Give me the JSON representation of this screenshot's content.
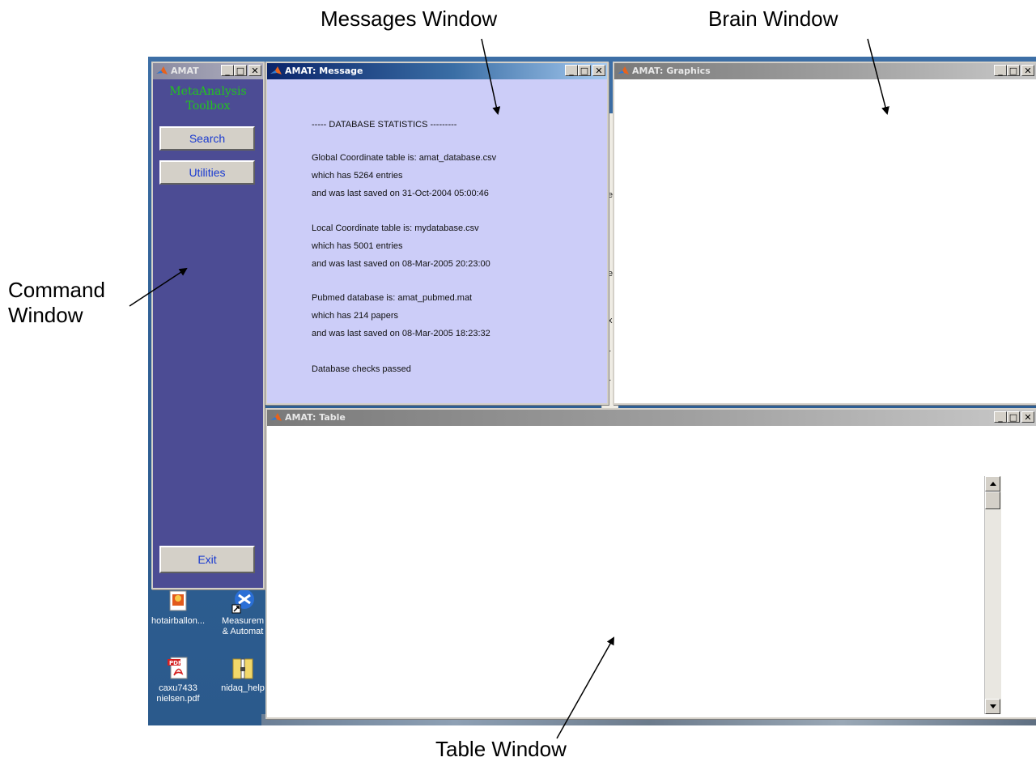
{
  "annotations": {
    "messages_label": "Messages Window",
    "brain_label": "Brain Window",
    "command_label_line1": "Command",
    "command_label_line2": "Window",
    "table_label": "Table Window"
  },
  "command_window": {
    "title": "AMAT",
    "heading_line1": "MetaAnalysis",
    "heading_line2": "Toolbox",
    "heading_color": "#22c41e",
    "panel_color": "#4c4c94",
    "buttons": {
      "search": "Search",
      "utilities": "Utilities",
      "exit": "Exit"
    }
  },
  "message_window": {
    "title": "AMAT: Message",
    "background": "#cccdf8",
    "lines": [
      "----- DATABASE STATISTICS ---------",
      "Global Coordinate table is: amat_database.csv",
      "which has 5264 entries",
      "and was last saved on 31-Oct-2004 05:00:46",
      "Local Coordinate table is: mydatabase.csv",
      "which has 5001 entries",
      "and was last saved on 08-Mar-2005 20:23:00",
      "Pubmed database is: amat_pubmed.mat",
      "which has 214 papers",
      "and was last saved on 08-Mar-2005 18:23:32",
      "Database checks passed"
    ]
  },
  "graphics_window": {
    "title": "AMAT: Graphics"
  },
  "table_window": {
    "title": "AMAT: Table"
  },
  "title_buttons": {
    "minimize": "_",
    "maximize": "□",
    "close": "✕"
  },
  "desktop_icons": [
    {
      "label_line1": "hotairballon...",
      "label_line2": "",
      "icon": "image-file-icon"
    },
    {
      "label_line1": "Measurem",
      "label_line2": "& Automat",
      "icon": "shortcut-app-icon"
    },
    {
      "label_line1": "caxu7433",
      "label_line2": "nielsen.pdf",
      "icon": "pdf-file-icon",
      "badge": "PDF"
    },
    {
      "label_line1": "nidaq_help",
      "label_line2": "",
      "icon": "zip-folder-icon"
    }
  ],
  "background_fragments": [
    "e",
    "e",
    "x",
    "r",
    "r"
  ]
}
